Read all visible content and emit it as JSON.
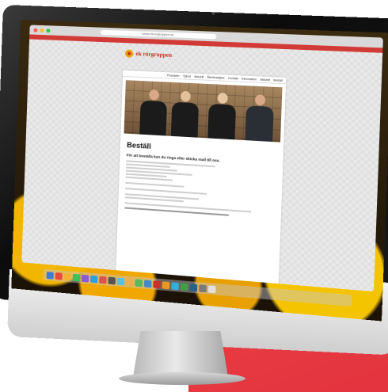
{
  "site": {
    "logo_text": "ek rörgruppen",
    "nav": [
      "Produkter",
      "Tjänst",
      "Aktuellt",
      "Återförsäljare",
      "Kontakt",
      "Information",
      "Aktuellt",
      "Beställ"
    ],
    "heading": "Beställ",
    "subheading": "För att beställa kan du ringa eller skicka mail till oss."
  },
  "browser": {
    "url": "www.ekrorgruppen.se"
  },
  "colors": {
    "accent": "#d13a36",
    "background_block": "#e3343f"
  },
  "icons": [
    "monitor",
    "camera",
    "dock-apps"
  ]
}
